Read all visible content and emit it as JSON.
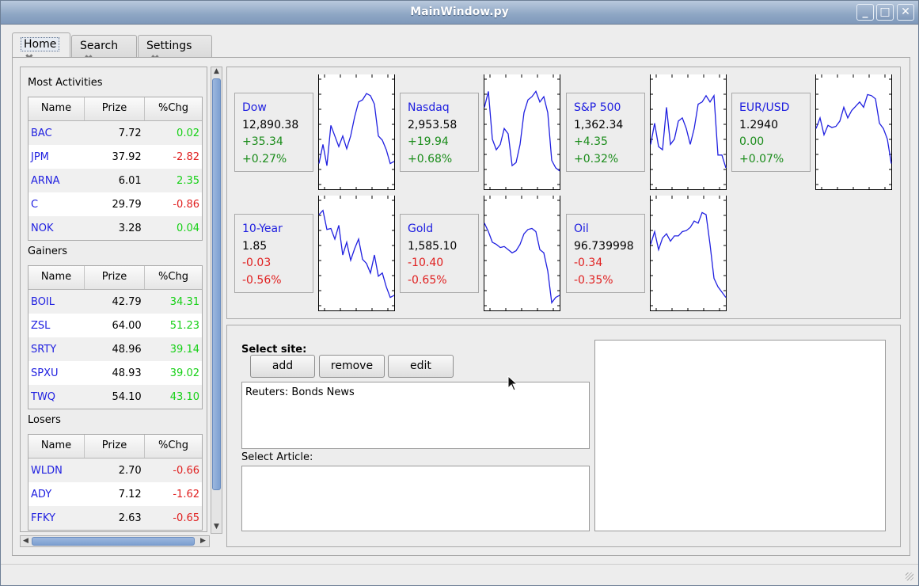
{
  "window": {
    "title": "MainWindow.py",
    "buttons": [
      "_",
      "□",
      "✕"
    ]
  },
  "tabs": [
    {
      "label": "Home",
      "active": true
    },
    {
      "label": "Search",
      "active": false
    },
    {
      "label": "Settings",
      "active": false
    }
  ],
  "left": {
    "headers": [
      "Name",
      "Prize",
      "%Chg"
    ],
    "sections": [
      {
        "title": "Most Activities",
        "rows": [
          [
            "BAC",
            "7.72",
            "0.02"
          ],
          [
            "JPM",
            "37.92",
            "-2.82"
          ],
          [
            "ARNA",
            "6.01",
            "2.35"
          ],
          [
            "C",
            "29.79",
            "-0.86"
          ],
          [
            "NOK",
            "3.28",
            "0.04"
          ]
        ]
      },
      {
        "title": "Gainers",
        "rows": [
          [
            "BOIL",
            "42.79",
            "34.31"
          ],
          [
            "ZSL",
            "64.00",
            "51.23"
          ],
          [
            "SRTY",
            "48.96",
            "39.14"
          ],
          [
            "SPXU",
            "48.93",
            "39.02"
          ],
          [
            "TWQ",
            "54.10",
            "43.10"
          ]
        ]
      },
      {
        "title": "Losers",
        "rows": [
          [
            "WLDN",
            "2.70",
            "-0.66"
          ],
          [
            "ADY",
            "7.12",
            "-1.62"
          ],
          [
            "FFKY",
            "2.63",
            "-0.65"
          ]
        ]
      }
    ]
  },
  "quotes": [
    {
      "name": "Dow",
      "value": "12,890.38",
      "change": "+35.34",
      "pct": "+0.27%",
      "dir": "up"
    },
    {
      "name": "Nasdaq",
      "value": "2,953.58",
      "change": "+19.94",
      "pct": "+0.68%",
      "dir": "up"
    },
    {
      "name": "S&P 500",
      "value": "1,362.34",
      "change": "+4.35",
      "pct": "+0.32%",
      "dir": "up"
    },
    {
      "name": "EUR/USD",
      "value": "1.2940",
      "change": "0.00",
      "pct": "+0.07%",
      "dir": "up"
    },
    {
      "name": "10-Year",
      "value": "1.85",
      "change": "-0.03",
      "pct": "-0.56%",
      "dir": "down"
    },
    {
      "name": "Gold",
      "value": "1,585.10",
      "change": "-10.40",
      "pct": "-0.65%",
      "dir": "down"
    },
    {
      "name": "Oil",
      "value": "96.739998",
      "change": "-0.34",
      "pct": "-0.35%",
      "dir": "down"
    }
  ],
  "sparklines": [
    [
      0.22,
      0.4,
      0.2,
      0.58,
      0.48,
      0.38,
      0.48,
      0.36,
      0.48,
      0.66,
      0.8,
      0.82,
      0.88,
      0.86,
      0.78,
      0.48,
      0.44,
      0.35,
      0.22,
      0.24
    ],
    [
      0.75,
      0.9,
      0.45,
      0.35,
      0.4,
      0.55,
      0.5,
      0.2,
      0.23,
      0.4,
      0.7,
      0.82,
      0.85,
      0.9,
      0.8,
      0.85,
      0.7,
      0.25,
      0.18,
      0.15
    ],
    [
      0.4,
      0.6,
      0.38,
      0.35,
      0.75,
      0.4,
      0.45,
      0.62,
      0.65,
      0.55,
      0.4,
      0.55,
      0.78,
      0.8,
      0.86,
      0.8,
      0.86,
      0.3,
      0.3,
      0.18
    ],
    [
      0.55,
      0.65,
      0.49,
      0.58,
      0.56,
      0.57,
      0.62,
      0.75,
      0.65,
      0.72,
      0.76,
      0.8,
      0.75,
      0.87,
      0.86,
      0.83,
      0.6,
      0.55,
      0.45,
      0.22
    ],
    [
      0.88,
      0.92,
      0.74,
      0.75,
      0.65,
      0.78,
      0.5,
      0.62,
      0.45,
      0.56,
      0.65,
      0.46,
      0.42,
      0.33,
      0.5,
      0.3,
      0.33,
      0.2,
      0.1,
      0.12
    ],
    [
      0.8,
      0.72,
      0.62,
      0.6,
      0.57,
      0.58,
      0.55,
      0.52,
      0.54,
      0.6,
      0.7,
      0.74,
      0.75,
      0.72,
      0.55,
      0.52,
      0.35,
      0.05,
      0.1,
      0.12
    ],
    [
      0.6,
      0.72,
      0.55,
      0.66,
      0.7,
      0.63,
      0.68,
      0.68,
      0.72,
      0.73,
      0.76,
      0.82,
      0.8,
      0.9,
      0.88,
      0.6,
      0.28,
      0.2,
      0.15,
      0.1
    ]
  ],
  "news": {
    "select_site_label": "Select site:",
    "add_label": "add",
    "remove_label": "remove",
    "edit_label": "edit",
    "sites": [
      "Reuters: Bonds News"
    ],
    "select_article_label": "Select Article:"
  },
  "colors": {
    "positive": "#17d017",
    "negative": "#e02020",
    "link": "#2020e0",
    "line": "#2020e0"
  }
}
